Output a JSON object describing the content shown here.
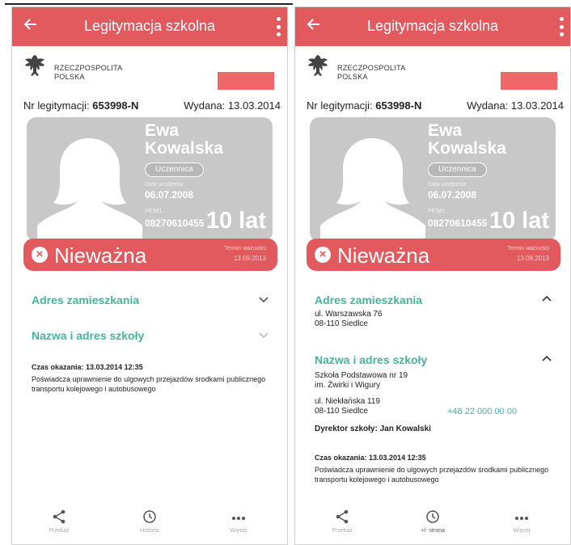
{
  "screens": [
    {
      "appbar": {
        "title": "Legitymacja szkolna"
      },
      "country": [
        "RZECZPOSPOLITA",
        "POLSKA"
      ],
      "meta": {
        "nr_label": "Nr legitymacji:",
        "nr_value": "653998-N",
        "issued_label": "Wydana:",
        "issued_value": "13.03.2014"
      },
      "card": {
        "first_name": "Ewa",
        "last_name": "Kowalska",
        "role": "Uczennica",
        "birth_label": "Data urodzenia",
        "birth_date": "06.07.2008",
        "pesel_label": "PESEL",
        "pesel": "08270610455",
        "age": "10 lat"
      },
      "status": {
        "text": "Nieważna",
        "valid_label": "Termin ważności",
        "valid_date": "13.09.2013"
      },
      "address_title": "Adres zamieszkania",
      "school_title": "Nazwa i adres szkoły",
      "shown_at": "Czas okazania: 13.03.2014 12:35",
      "desc": "Poświadcza uprawnienie do ulgowych przejazdów środkami publicznego transportu kolejowego i autobusowego",
      "nav": {
        "share": "Przekaż",
        "history": "Historia",
        "more": "Więcej"
      }
    },
    {
      "appbar": {
        "title": "Legitymacja szkolna"
      },
      "country": [
        "RZECZPOSPOLITA",
        "POLSKA"
      ],
      "meta": {
        "nr_label": "Nr legitymacji:",
        "nr_value": "653998-N",
        "issued_label": "Wydana:",
        "issued_value": "13.03.2014"
      },
      "card": {
        "first_name": "Ewa",
        "last_name": "Kowalska",
        "role": "Uczennica",
        "birth_label": "Data urodzenia",
        "birth_date": "06.07.2008",
        "pesel_label": "PESEL",
        "pesel": "08270610455",
        "age": "10 lat"
      },
      "status": {
        "text": "Nieważna",
        "valid_label": "Termin ważności",
        "valid_date": "13.09.2013"
      },
      "address_title": "Adres zamieszkania",
      "address_lines": [
        "ul. Warszawska 76",
        "08-110 Siedlce"
      ],
      "school_title": "Nazwa i adres szkoły",
      "school_lines": [
        "Szkoła Podstawowa nr 19",
        "im. Żwirki i Wigury"
      ],
      "school_addr": [
        "ul. Niekłańska 119",
        "08-110 Siedlce"
      ],
      "school_phone": "+48 22 000 00 00",
      "director": "Dyrektor szkoły: Jan Kowalski",
      "shown_at": "Czas okazania: 13.03.2014 12:35",
      "desc": "Poświadcza uprawnienie do ulgowych przejazdów środkami publicznego transportu kolejowego i autobusowego",
      "nav": {
        "share": "Przekaż",
        "history": "Historia",
        "history_hint": "+/- strona",
        "more": "Więcej"
      }
    }
  ],
  "colors": {
    "accent": "#e25a5d",
    "section": "#48b39b",
    "card": "#c8c8c8",
    "flag_red": "#ef6667"
  }
}
